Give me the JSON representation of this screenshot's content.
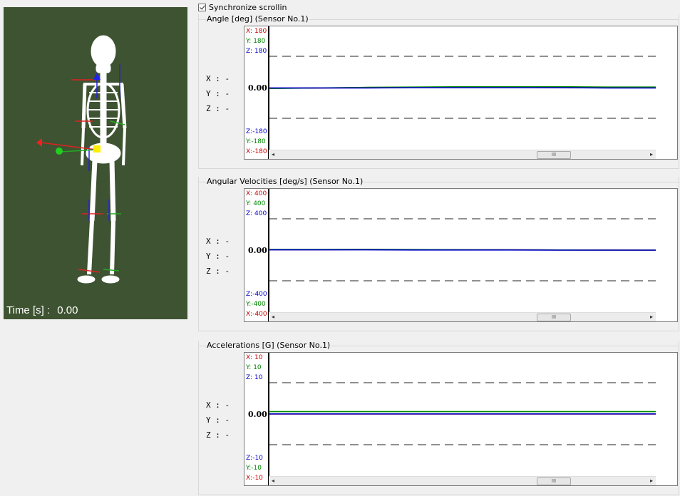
{
  "viewport": {
    "background": "#3e5331",
    "time_label": "Time [s] :",
    "time_value": "0.00"
  },
  "sync": {
    "label": "Synchronize scrollin",
    "checked": true
  },
  "panels": [
    {
      "title": "Angle [deg] (Sensor No.1)",
      "readout": {
        "x": "X : -",
        "y": "Y : -",
        "z": "Z : -"
      },
      "top_labels": {
        "x": "X: 180",
        "y": "Y: 180",
        "z": "Z: 180"
      },
      "bottom_labels": {
        "z": "Z:-180",
        "y": "Y:-180",
        "x": "X:-180"
      },
      "zero_label": "0.00",
      "chart_data": {
        "type": "line",
        "ylim": [
          -180,
          180
        ],
        "series": [
          {
            "name": "X",
            "color": "#cc0000",
            "values": [
              -2,
              -1,
              0,
              1,
              1,
              1,
              0,
              0,
              0
            ]
          },
          {
            "name": "Y",
            "color": "#008800",
            "values": [
              -3,
              -1,
              1,
              2,
              3,
              3,
              3,
              2,
              2
            ]
          },
          {
            "name": "Z",
            "color": "#0000cc",
            "values": [
              -1,
              -1,
              -1,
              0,
              0,
              0,
              0,
              -1,
              -1
            ]
          }
        ]
      }
    },
    {
      "title": "Angular Velocities [deg/s] (Sensor No.1)",
      "readout": {
        "x": "X : -",
        "y": "Y : -",
        "z": "Z : -"
      },
      "top_labels": {
        "x": "X: 400",
        "y": "Y: 400",
        "z": "Z: 400"
      },
      "bottom_labels": {
        "z": "Z:-400",
        "y": "Y:-400",
        "x": "X:-400"
      },
      "zero_label": "0.00",
      "chart_data": {
        "type": "line",
        "ylim": [
          -400,
          400
        ],
        "series": [
          {
            "name": "X",
            "color": "#cc0000",
            "values": [
              3,
              3,
              4,
              3,
              2,
              2,
              1,
              1,
              0
            ]
          },
          {
            "name": "Y",
            "color": "#008800",
            "values": [
              5,
              5,
              6,
              4,
              3,
              2,
              1,
              0,
              0
            ]
          },
          {
            "name": "Z",
            "color": "#0000cc",
            "values": [
              2,
              2,
              2,
              1,
              1,
              1,
              0,
              0,
              0
            ]
          }
        ]
      }
    },
    {
      "title": "Accelerations  [G] (Sensor No.1)",
      "readout": {
        "x": "X : -",
        "y": "Y : -",
        "z": "Z : -"
      },
      "top_labels": {
        "x": "X: 10",
        "y": "Y: 10",
        "z": "Z: 10"
      },
      "bottom_labels": {
        "z": "Z:-10",
        "y": "Y:-10",
        "x": "X:-10"
      },
      "zero_label": "0.00",
      "chart_data": {
        "type": "line",
        "ylim": [
          -10,
          10
        ],
        "series": [
          {
            "name": "X",
            "color": "#cc0000",
            "values": [
              0,
              0,
              0,
              0,
              0,
              0,
              0,
              0,
              0
            ]
          },
          {
            "name": "Y",
            "color": "#008800",
            "values": [
              0.45,
              0.45,
              0.45,
              0.45,
              0.45,
              0.45,
              0.45,
              0.45,
              0.45
            ]
          },
          {
            "name": "Z",
            "color": "#0000cc",
            "values": [
              0.02,
              0.02,
              0.02,
              0.02,
              0.02,
              0.02,
              0.02,
              0.02,
              0.02
            ]
          }
        ]
      }
    }
  ],
  "scrollbar": {
    "thumb": "III"
  }
}
